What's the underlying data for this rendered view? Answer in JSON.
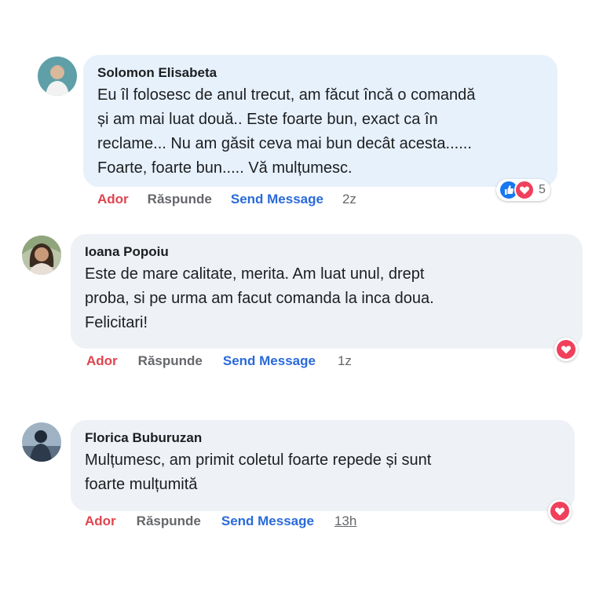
{
  "colors": {
    "love": "#e0444e",
    "reply": "#65676b",
    "send_message": "#2a6ad9",
    "bubble_blue": "#e7f1fc",
    "bubble_gray": "#eef1f5",
    "heart": "#f0405c"
  },
  "comments": [
    {
      "author": "Solomon Elisabeta",
      "lines": [
        "Eu îl folosesc de anul trecut, am făcut încă o comandă",
        "și am mai luat două.. Este foarte bun, exact ca în",
        "reclame... Nu am găsit ceva mai bun decât acesta......",
        "Foarte, foarte bun..... Vă mulțumesc."
      ],
      "actions": {
        "love": "Ador",
        "reply": "Răspunde",
        "send_message": "Send Message",
        "time": "2z"
      },
      "reactions": {
        "icons": [
          "like-icon",
          "love-icon"
        ],
        "count": "5"
      }
    },
    {
      "author": "Ioana Popoiu",
      "lines": [
        "Este de mare calitate, merita. Am luat unul, drept",
        "proba, si pe urma am facut comanda la inca doua.",
        "Felicitari!"
      ],
      "actions": {
        "love": "Ador",
        "reply": "Răspunde",
        "send_message": "Send Message",
        "time": "1z"
      },
      "reactions": {
        "icons": [
          "love-icon"
        ]
      }
    },
    {
      "author": "Florica Buburuzan",
      "lines": [
        "Mulțumesc, am primit coletul foarte repede și sunt",
        "foarte mulțumită"
      ],
      "actions": {
        "love": "Ador",
        "reply": "Răspunde",
        "send_message": "Send Message",
        "time": "13h"
      },
      "reactions": {
        "icons": [
          "love-icon"
        ]
      }
    }
  ]
}
